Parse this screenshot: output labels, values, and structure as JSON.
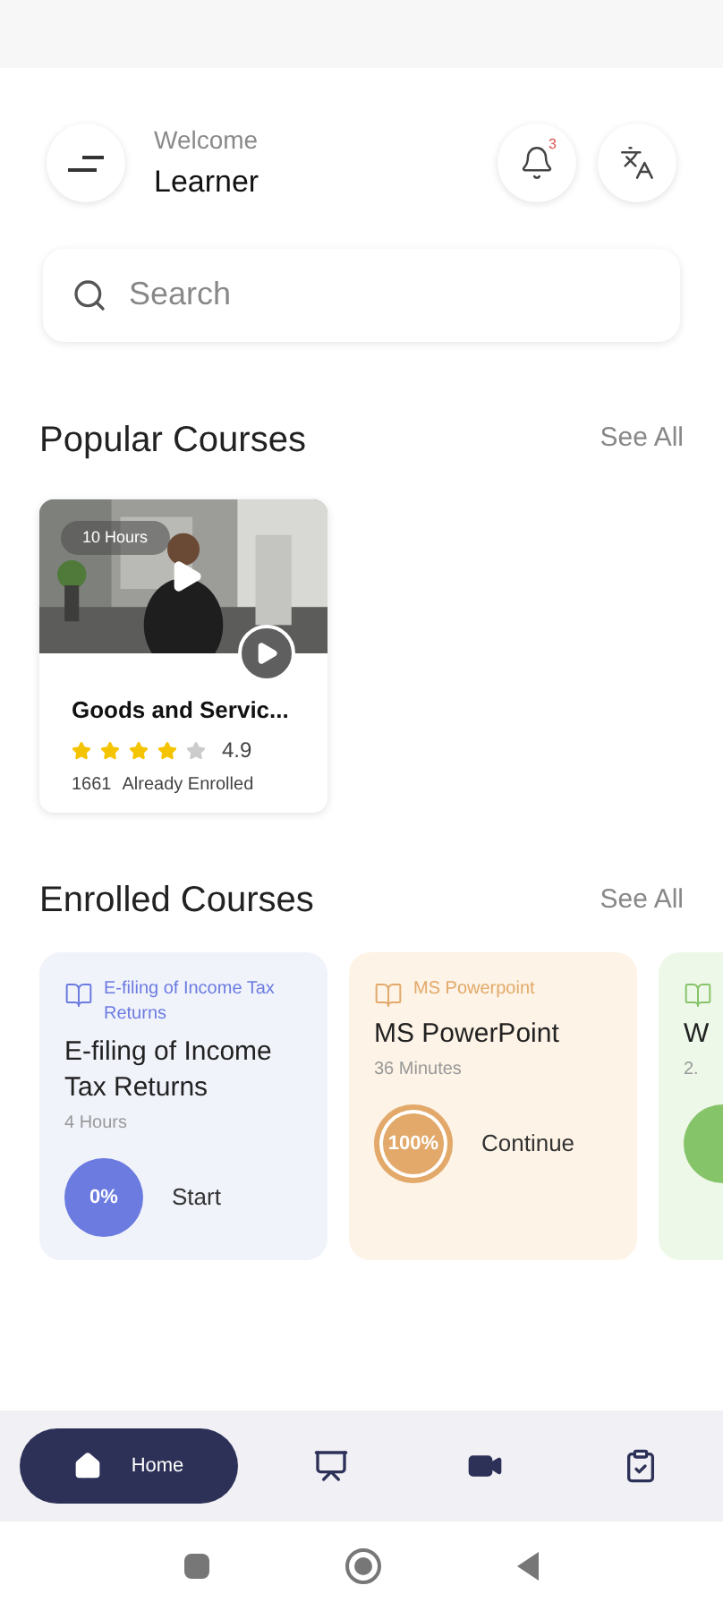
{
  "header": {
    "greeting": "Welcome",
    "name": "Learner",
    "notification_count": "3"
  },
  "search": {
    "placeholder": "Search"
  },
  "popular": {
    "title": "Popular Courses",
    "see_all": "See All",
    "courses": [
      {
        "kind": "picture",
        "duration": "10 Hours",
        "title": "Goods and Servic...",
        "stars": 4,
        "rating": "4.9",
        "enrolled": "1661",
        "enrolled_label": "Already Enrolled"
      }
    ]
  },
  "enrolled": {
    "title": "Enrolled Courses",
    "see_all": "See All",
    "courses": [
      {
        "category": "E-filing of Income Tax Returns",
        "title": "E-filing of Income Tax Returns",
        "duration": "4 Hours",
        "progress": "0%",
        "kind": "solid",
        "action": "Start",
        "color": "#6b7be0"
      },
      {
        "category": "MS Powerpoint",
        "title": "MS PowerPoint",
        "duration": "36 Minutes",
        "progress": "100%",
        "kind": "ring",
        "action": "Continue",
        "color": "#e2a96a"
      },
      {
        "title": "W",
        "duration": "2.",
        "kind": "solid",
        "color": "#86c46a"
      }
    ]
  },
  "bottom_nav": [
    {
      "kind": "home",
      "label": "Home",
      "selected": true
    },
    {
      "kind": "learning",
      "selected": false
    },
    {
      "kind": "video",
      "selected": false
    },
    {
      "kind": "tasks",
      "selected": false
    }
  ]
}
